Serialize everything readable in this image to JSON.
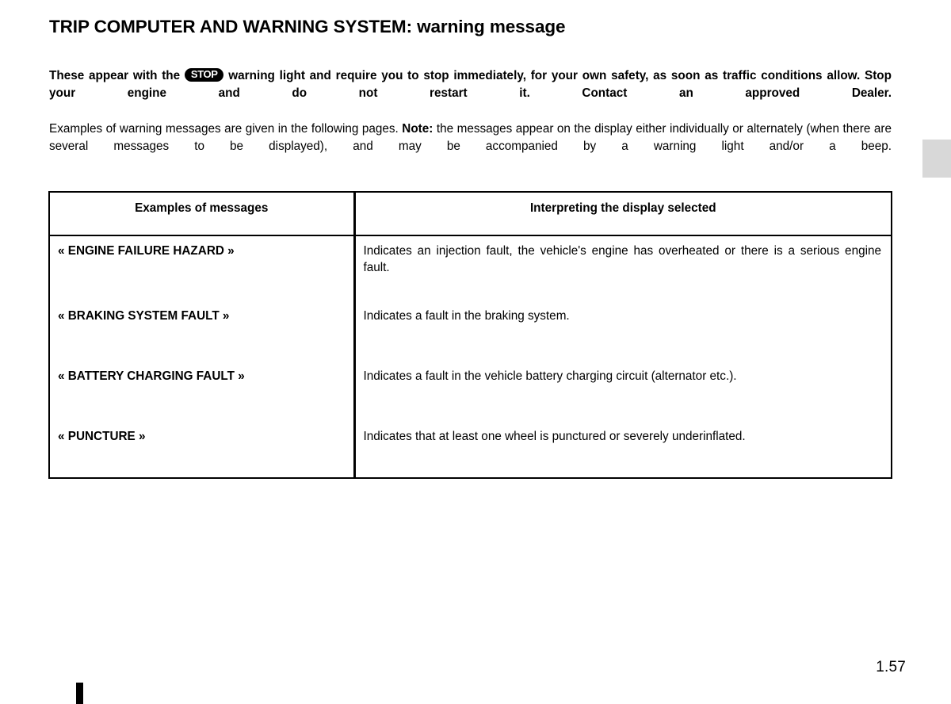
{
  "document": {
    "title_main": "TRIP COMPUTER AND WARNING SYSTEM:",
    "title_sub": " warning message",
    "page_number": "1.57"
  },
  "intro": {
    "bold_paragraph": {
      "before_badge": "These appear with the ",
      "badge_label": "STOP",
      "after_badge": " warning light and require you to stop immediately, for your own safety, as soon as traffic conditions allow. Stop your engine and do not restart it. Contact an approved Dealer."
    },
    "regular_paragraph": {
      "before_note": "Examples of warning messages are given in the following pages. ",
      "note_label": "Note:",
      "after_note": " the messages appear on the display either individually or alternately (when there are several messages to be displayed), and may be accompanied by a warning light and/or a beep."
    }
  },
  "table": {
    "headers": {
      "left": "Examples of messages",
      "right": "Interpreting the display selected"
    },
    "rows": [
      {
        "message": "« ENGINE FAILURE HAZARD »",
        "description": "Indicates an injection fault, the vehicle's engine has overheated or there is a serious engine fault."
      },
      {
        "message": "« BRAKING SYSTEM FAULT »",
        "description": "Indicates a fault in the braking system."
      },
      {
        "message": "« BATTERY CHARGING FAULT »",
        "description": "Indicates a fault in the vehicle battery charging circuit (alternator etc.)."
      },
      {
        "message": "« PUNCTURE »",
        "description": "Indicates that at least one wheel is punctured or severely underinflated."
      }
    ]
  },
  "colors": {
    "text": "#000000",
    "page_background": "#ffffff",
    "thumb_tab": "#d8d8d8",
    "badge_background": "#000000",
    "badge_text": "#ffffff"
  }
}
